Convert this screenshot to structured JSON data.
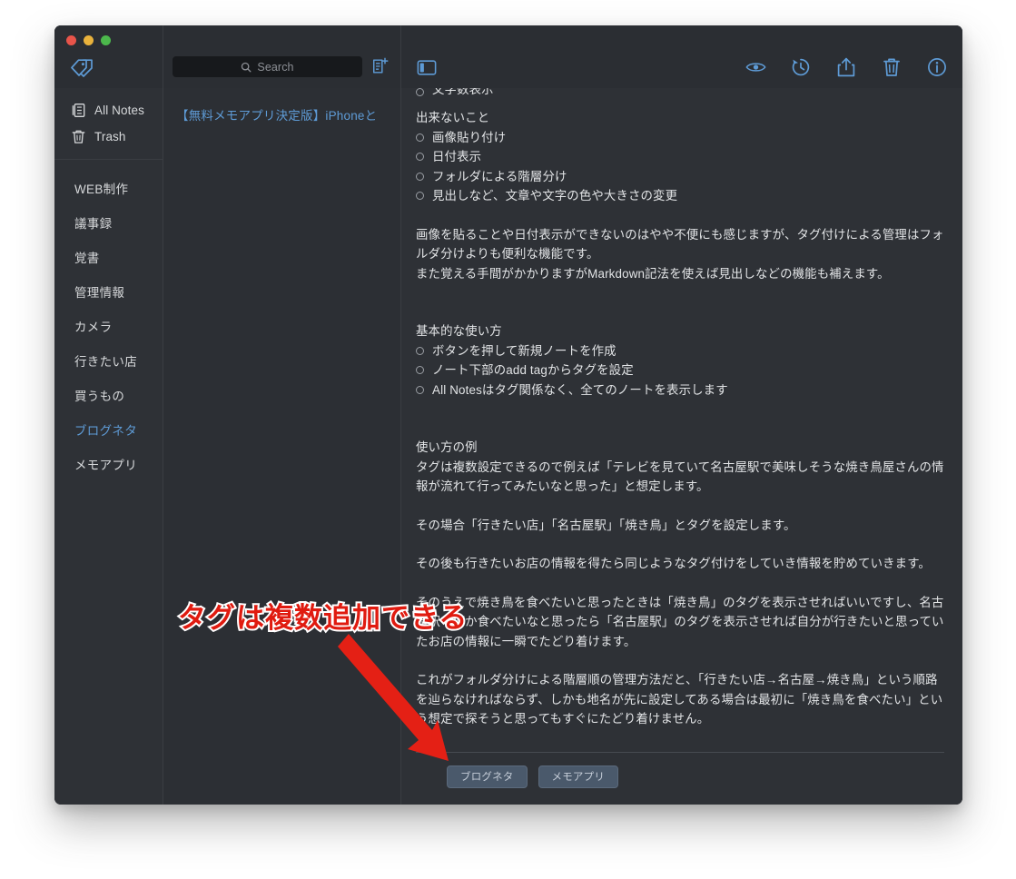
{
  "window": {
    "traffic_lights": [
      "close",
      "minimize",
      "maximize"
    ]
  },
  "toolbar": {
    "tag_icon": "tag-icon",
    "search": {
      "value": "",
      "placeholder": "Search",
      "icon": "search-icon"
    },
    "new_note_icon": "new-note-icon",
    "sidebar_toggle_icon": "sidebar-toggle-icon",
    "right_icons": [
      {
        "name": "preview-eye-icon",
        "glyph": "eye"
      },
      {
        "name": "history-icon",
        "glyph": "clock-arrow"
      },
      {
        "name": "share-icon",
        "glyph": "share-up"
      },
      {
        "name": "delete-icon",
        "glyph": "trash"
      },
      {
        "name": "info-icon",
        "glyph": "info-circle"
      }
    ]
  },
  "sidebar": {
    "system_items": [
      {
        "label": "All Notes",
        "icon": "notes-icon"
      },
      {
        "label": "Trash",
        "icon": "trash-icon"
      }
    ],
    "tags": [
      {
        "label": "WEB制作",
        "active": false
      },
      {
        "label": "議事録",
        "active": false
      },
      {
        "label": "覚書",
        "active": false
      },
      {
        "label": "管理情報",
        "active": false
      },
      {
        "label": "カメラ",
        "active": false
      },
      {
        "label": "行きたい店",
        "active": false
      },
      {
        "label": "買うもの",
        "active": false
      },
      {
        "label": "ブログネタ",
        "active": true
      },
      {
        "label": "メモアプリ",
        "active": false
      }
    ]
  },
  "note_list": {
    "items": [
      {
        "title": "【無料メモアプリ決定版】iPhoneと"
      }
    ]
  },
  "note": {
    "clipped_top_line": "文字数表示",
    "blocks": [
      {
        "type": "heading",
        "text": "出来ないこと"
      },
      {
        "type": "bullet",
        "text": "画像貼り付け"
      },
      {
        "type": "bullet",
        "text": "日付表示"
      },
      {
        "type": "bullet",
        "text": "フォルダによる階層分け"
      },
      {
        "type": "bullet",
        "text": "見出しなど、文章や文字の色や大きさの変更"
      },
      {
        "type": "blank"
      },
      {
        "type": "para",
        "text": "画像を貼ることや日付表示ができないのはやや不便にも感じますが、タグ付けによる管理はフォルダ分けよりも便利な機能です。"
      },
      {
        "type": "para",
        "text": "また覚える手間がかかりますがMarkdown記法を使えば見出しなどの機能も補えます。"
      },
      {
        "type": "blank"
      },
      {
        "type": "blank"
      },
      {
        "type": "heading",
        "text": "基本的な使い方"
      },
      {
        "type": "bullet",
        "text": "ボタンを押して新規ノートを作成"
      },
      {
        "type": "bullet",
        "text": "ノート下部のadd tagからタグを設定"
      },
      {
        "type": "bullet",
        "text": "All Notesはタグ関係なく、全てのノートを表示します"
      },
      {
        "type": "blank"
      },
      {
        "type": "blank"
      },
      {
        "type": "heading",
        "text": "使い方の例"
      },
      {
        "type": "para",
        "text": "タグは複数設定できるので例えば「テレビを見ていて名古屋駅で美味しそうな焼き鳥屋さんの情報が流れて行ってみたいなと思った」と想定します。"
      },
      {
        "type": "blank"
      },
      {
        "type": "para",
        "text": "その場合「行きたい店」「名古屋駅」「焼き鳥」とタグを設定します。"
      },
      {
        "type": "blank"
      },
      {
        "type": "para",
        "text": "その後も行きたいお店の情報を得たら同じようなタグ付けをしていき情報を貯めていきます。"
      },
      {
        "type": "blank"
      },
      {
        "type": "para",
        "text": "そのうえで焼き鳥を食べたいと思ったときは「焼き鳥」のタグを表示させればいいですし、名古屋駅で何か食べたいなと思ったら「名古屋駅」のタグを表示させれば自分が行きたいと思っていたお店の情報に一瞬でたどり着けます。"
      },
      {
        "type": "blank"
      },
      {
        "type": "para",
        "text": "これがフォルダ分けによる階層順の管理方法だと、「行きたい店→名古屋→焼き鳥」という順路を辿らなければならず、しかも地名が先に設定してある場合は最初に「焼き鳥を食べたい」という想定で探そうと思ってもすぐにたどり着けません。"
      }
    ],
    "tags": [
      "ブログネタ",
      "メモアプリ"
    ]
  },
  "annotation": {
    "text": "タグは複数追加できる",
    "text_color": "#e01b10",
    "outline_color": "#ffffff",
    "arrow_color": "#e42015"
  },
  "colors": {
    "window_bg": "#2e3136",
    "titlebar_bg": "#2b2e33",
    "notelist_bg": "#2c2f34",
    "accent_blue": "#5e9bd6",
    "text_primary": "#e2e4e6",
    "search_bg": "#17191c",
    "tag_chip_bg": "#4a596b"
  }
}
